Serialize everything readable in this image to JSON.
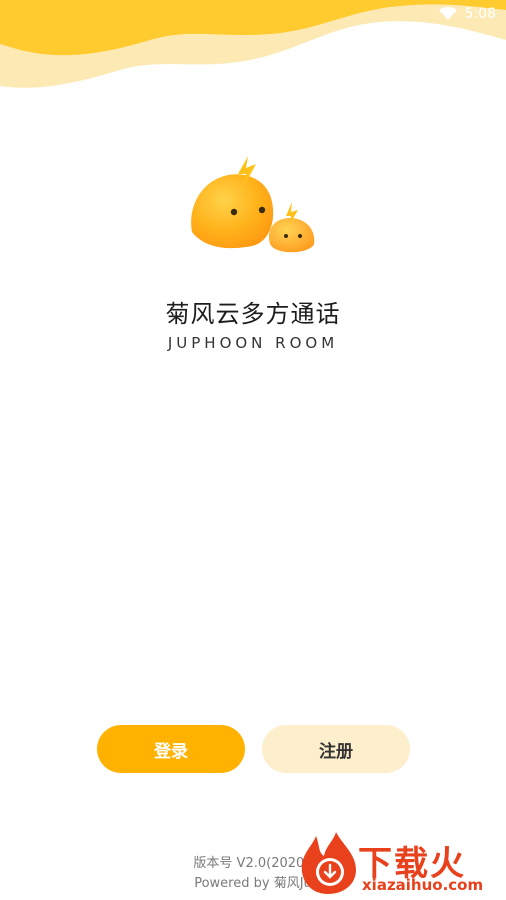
{
  "status_bar": {
    "time": "5:08",
    "icons": [
      "wifi-icon"
    ]
  },
  "brand": {
    "title": "菊风云多方通话",
    "subtitle": "JUPHOON ROOM",
    "logo": "blob-mascot-logo"
  },
  "actions": {
    "login_label": "登录",
    "register_label": "注册"
  },
  "footer": {
    "version": "版本号 V2.0(20200",
    "powered_by": "Powered by 菊风Ju"
  },
  "watermark": {
    "text": "下载火",
    "url": "xiazaihuo.com"
  },
  "colors": {
    "accent": "#ffb300",
    "accent_light": "#fdefcc",
    "header_wave_dark": "#ffcb2e",
    "header_wave_light": "#fde9b4",
    "watermark": "#e8411c"
  }
}
